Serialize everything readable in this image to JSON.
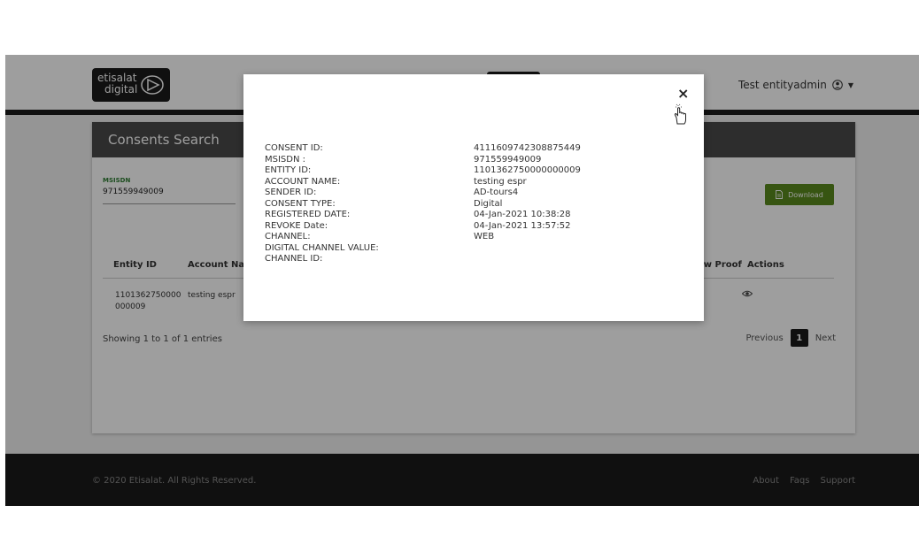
{
  "header": {
    "logo_line1": "etisalat",
    "logo_line2": "digital",
    "user_name": "Test entityadmin"
  },
  "card": {
    "title": "Consents Search",
    "msisdn_label": "MSISDN",
    "msisdn_value": "971559949009",
    "download_label": "Download"
  },
  "table": {
    "headers": [
      "Entity ID",
      "Account Nam",
      "ew Proof",
      "Actions"
    ],
    "row": {
      "entity_id_1": "1101362750000",
      "entity_id_2": "000009",
      "account_name": "testing espr"
    }
  },
  "pagination": {
    "showing": "Showing 1 to 1 of 1 entries",
    "previous": "Previous",
    "current_page": "1",
    "next": "Next"
  },
  "footer": {
    "copyright": "© 2020 Etisalat. All Rights Reserved.",
    "links": [
      "About",
      "Faqs",
      "Support"
    ]
  },
  "modal": {
    "close_label": "×",
    "fields": [
      {
        "key": "CONSENT ID:",
        "value": "4111609742308875449"
      },
      {
        "key": "MSISDN :",
        "value": "971559949009"
      },
      {
        "key": "ENTITY ID:",
        "value": "1101362750000000009"
      },
      {
        "key": "ACCOUNT NAME:",
        "value": "testing espr"
      },
      {
        "key": "SENDER ID:",
        "value": "AD-tours4"
      },
      {
        "key": "CONSENT TYPE:",
        "value": "Digital"
      },
      {
        "key": "REGISTERED DATE:",
        "value": "04-Jan-2021 10:38:28"
      },
      {
        "key": "REVOKE Date:",
        "value": "04-Jan-2021 13:57:52"
      },
      {
        "key": "CHANNEL:",
        "value": "WEB"
      },
      {
        "key": "DIGITAL CHANNEL VALUE:",
        "value": ""
      },
      {
        "key": "CHANNEL ID:",
        "value": ""
      }
    ]
  },
  "icons": {
    "user": "user-circle-icon",
    "download": "file-icon",
    "action": "eye-icon",
    "close": "close-icon",
    "cursor": "hand-pointer-icon"
  },
  "colors": {
    "accent": "#5a8a1e",
    "header_dark": "#1a1a1a",
    "card_head": "#4a4a4a"
  }
}
